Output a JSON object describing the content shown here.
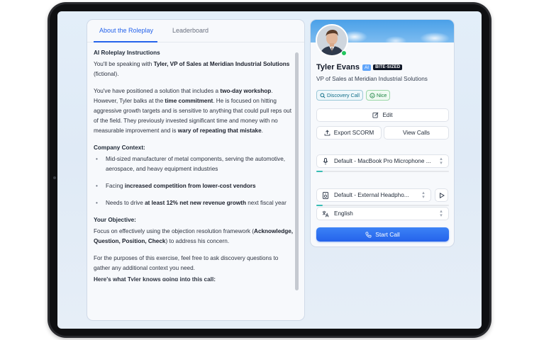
{
  "tabs": [
    {
      "label": "About the Roleplay",
      "active": true
    },
    {
      "label": "Leaderboard",
      "active": false
    }
  ],
  "instructions": {
    "heading": "AI Roleplay Instructions",
    "p1": {
      "a": "You'll be speaking with ",
      "b": "Tyler, VP of Sales at Meridian Industrial Solutions",
      "c": " (fictional)."
    },
    "p2": {
      "a": "You've have positioned a solution that includes a ",
      "b": "two-day workshop",
      "c": ". However, Tyler balks at the ",
      "d": "time commitment",
      "e": ". He is focused on hitting aggressive growth targets and is sensitive to anything that could pull reps out of the field. They previously invested significant time and money with no measurable improvement and is ",
      "f": "wary of repeating that mistake",
      "g": "."
    },
    "company_heading": "Company Context:",
    "company_items": [
      {
        "a": "Mid-sized manufacturer of metal components, serving the automotive, aerospace, and heavy equipment industries",
        "b": "",
        "c": ""
      },
      {
        "a": "Facing ",
        "b": "increased competition from lower-cost vendors",
        "c": ""
      },
      {
        "a": "Needs to drive ",
        "b": "at least 12% net new revenue growth",
        "c": " next fiscal year"
      }
    ],
    "objective_heading": "Your Objective:",
    "objective": {
      "a": "Focus on effectively using the objection resolution framework (",
      "b": "Acknowledge, Question, Position, Check",
      "c": ") to address his concern."
    },
    "purposes": "For the purposes of this exercise, feel free to ask discovery questions to gather any additional context you need.",
    "cut_line": "Here's what Tyler knows going into this call:"
  },
  "profile": {
    "name": "Tyler Evans",
    "ai_badge": "AI",
    "format_badge": "BITE-SIZED",
    "title": "VP of Sales at Meridian Industrial Solutions",
    "tags": [
      {
        "label": "Discovery Call",
        "icon": "search-icon"
      },
      {
        "label": "Nice",
        "icon": "smile-icon"
      }
    ]
  },
  "actions": {
    "edit": "Edit",
    "export": "Export SCORM",
    "view_calls": "View Calls",
    "start_call": "Start Call"
  },
  "devices": {
    "microphone": "Default - MacBook Pro Microphone ...",
    "microphone_level": 0.05,
    "speaker": "Default - External Headpho...",
    "speaker_level": 0.05,
    "language": "English"
  },
  "colors": {
    "accent": "#2563eb",
    "online": "#22c55e",
    "level": "#38bdb4"
  }
}
